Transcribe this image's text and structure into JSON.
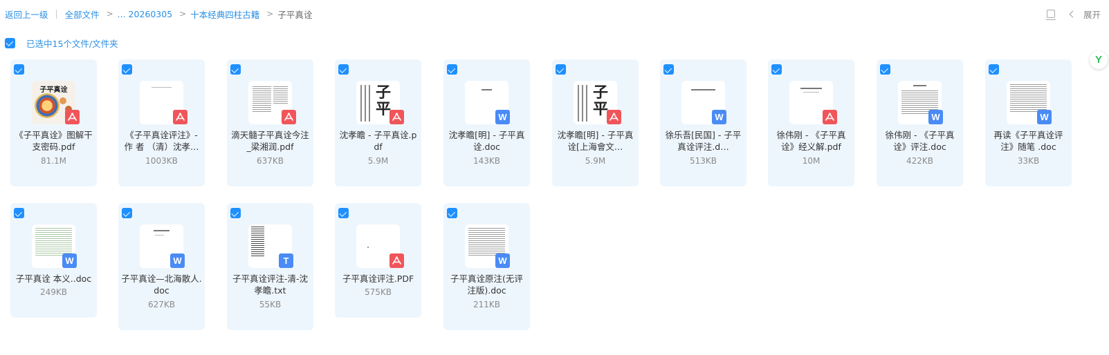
{
  "breadcrumb": {
    "back": "返回上一级",
    "all_files": "全部文件",
    "ellipsis_date": "... 20260305",
    "folder": "十本经典四柱古籍",
    "current": "子平真诠",
    "divider": "|",
    "separator": ">"
  },
  "toolbar": {
    "expand_label": "展开",
    "list_icon": "list-view-icon",
    "chevron_icon": "chevron-left-icon"
  },
  "selection": {
    "label": "已选中15个文件/文件夹",
    "checked": true
  },
  "float_badge": {
    "glyph": "Y"
  },
  "colors": {
    "accent": "#2b8fe3",
    "card_bg": "#eef6fd",
    "checkbox": "#1e90ff",
    "pdf": "#f0555a",
    "doc": "#4a8bf5"
  },
  "files": [
    {
      "name": "《子平真诠》图解干支密码.pdf",
      "size": "81.1M",
      "type": "pdf"
    },
    {
      "name": "《子平真诠评注》- 作 者 （清）沈孝…",
      "size": "1003KB",
      "type": "pdf"
    },
    {
      "name": "滴天髓子平真诠今注_梁湘润.pdf",
      "size": "637KB",
      "type": "pdf"
    },
    {
      "name": "沈孝瞻 - 子平真诠.pdf",
      "size": "5.9M",
      "type": "pdf"
    },
    {
      "name": "沈孝瞻[明] - 子平真诠.doc",
      "size": "143KB",
      "type": "doc"
    },
    {
      "name": "沈孝瞻[明] - 子平真诠[上海會文…",
      "size": "5.9M",
      "type": "pdf"
    },
    {
      "name": "徐乐吾[民国] - 子平真诠评注.d…",
      "size": "513KB",
      "type": "doc"
    },
    {
      "name": "徐伟刚 - 《子平真诠》经义解.pdf",
      "size": "10M",
      "type": "pdf"
    },
    {
      "name": "徐伟刚 - 《子平真诠》评注.doc",
      "size": "422KB",
      "type": "doc"
    },
    {
      "name": "再读《子平真诠评注》随笔 .doc",
      "size": "33KB",
      "type": "doc"
    },
    {
      "name": "子平真诠 本义..doc",
      "size": "249KB",
      "type": "doc"
    },
    {
      "name": "子平真诠—北海散人.doc",
      "size": "627KB",
      "type": "doc"
    },
    {
      "name": "子平真诠评注-清-沈孝瞻.txt",
      "size": "55KB",
      "type": "txt"
    },
    {
      "name": "子平真诠评注.PDF",
      "size": "575KB",
      "type": "pdf"
    },
    {
      "name": "子平真诠原注(无评注版).doc",
      "size": "211KB",
      "type": "doc"
    }
  ],
  "cover": {
    "title": "子平真诠"
  },
  "thumb_chars": {
    "c1": "子",
    "c2": "平",
    "c3": "真",
    "c4": "子",
    "c5": "平"
  },
  "badges": {
    "pdf_icon": "pdf-icon",
    "doc_glyph": "W",
    "txt_glyph": "T"
  }
}
